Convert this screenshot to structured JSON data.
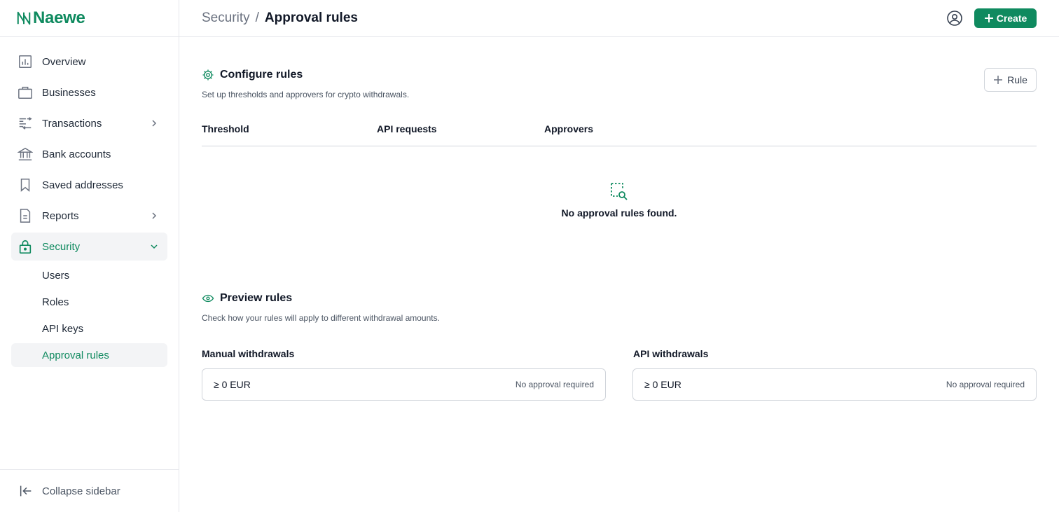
{
  "brand": {
    "name": "Naewe",
    "color": "#0f8a5f"
  },
  "sidebar": {
    "items": [
      {
        "label": "Overview",
        "icon": "chart-bar-icon",
        "has_chevron": false
      },
      {
        "label": "Businesses",
        "icon": "briefcase-icon",
        "has_chevron": false
      },
      {
        "label": "Transactions",
        "icon": "transactions-icon",
        "has_chevron": true
      },
      {
        "label": "Bank accounts",
        "icon": "bank-icon",
        "has_chevron": false
      },
      {
        "label": "Saved addresses",
        "icon": "bookmark-icon",
        "has_chevron": false
      },
      {
        "label": "Reports",
        "icon": "document-icon",
        "has_chevron": true
      },
      {
        "label": "Security",
        "icon": "lock-icon",
        "has_chevron": true,
        "expanded": true,
        "active": true
      }
    ],
    "subitems": [
      {
        "label": "Users"
      },
      {
        "label": "Roles"
      },
      {
        "label": "API keys"
      },
      {
        "label": "Approval rules",
        "active": true
      }
    ],
    "collapse_label": "Collapse sidebar"
  },
  "header": {
    "breadcrumb": {
      "parent": "Security",
      "separator": "/",
      "current": "Approval rules"
    },
    "create_label": "Create"
  },
  "configure": {
    "title": "Configure rules",
    "description": "Set up thresholds and approvers for crypto withdrawals.",
    "add_rule_label": "Rule",
    "columns": [
      "Threshold",
      "API requests",
      "Approvers"
    ],
    "empty_message": "No approval rules found."
  },
  "preview": {
    "title": "Preview rules",
    "description": "Check how your rules will apply to different withdrawal amounts.",
    "manual": {
      "label": "Manual withdrawals",
      "amount": "≥ 0 EUR",
      "status": "No approval required"
    },
    "api": {
      "label": "API withdrawals",
      "amount": "≥ 0 EUR",
      "status": "No approval required"
    }
  }
}
